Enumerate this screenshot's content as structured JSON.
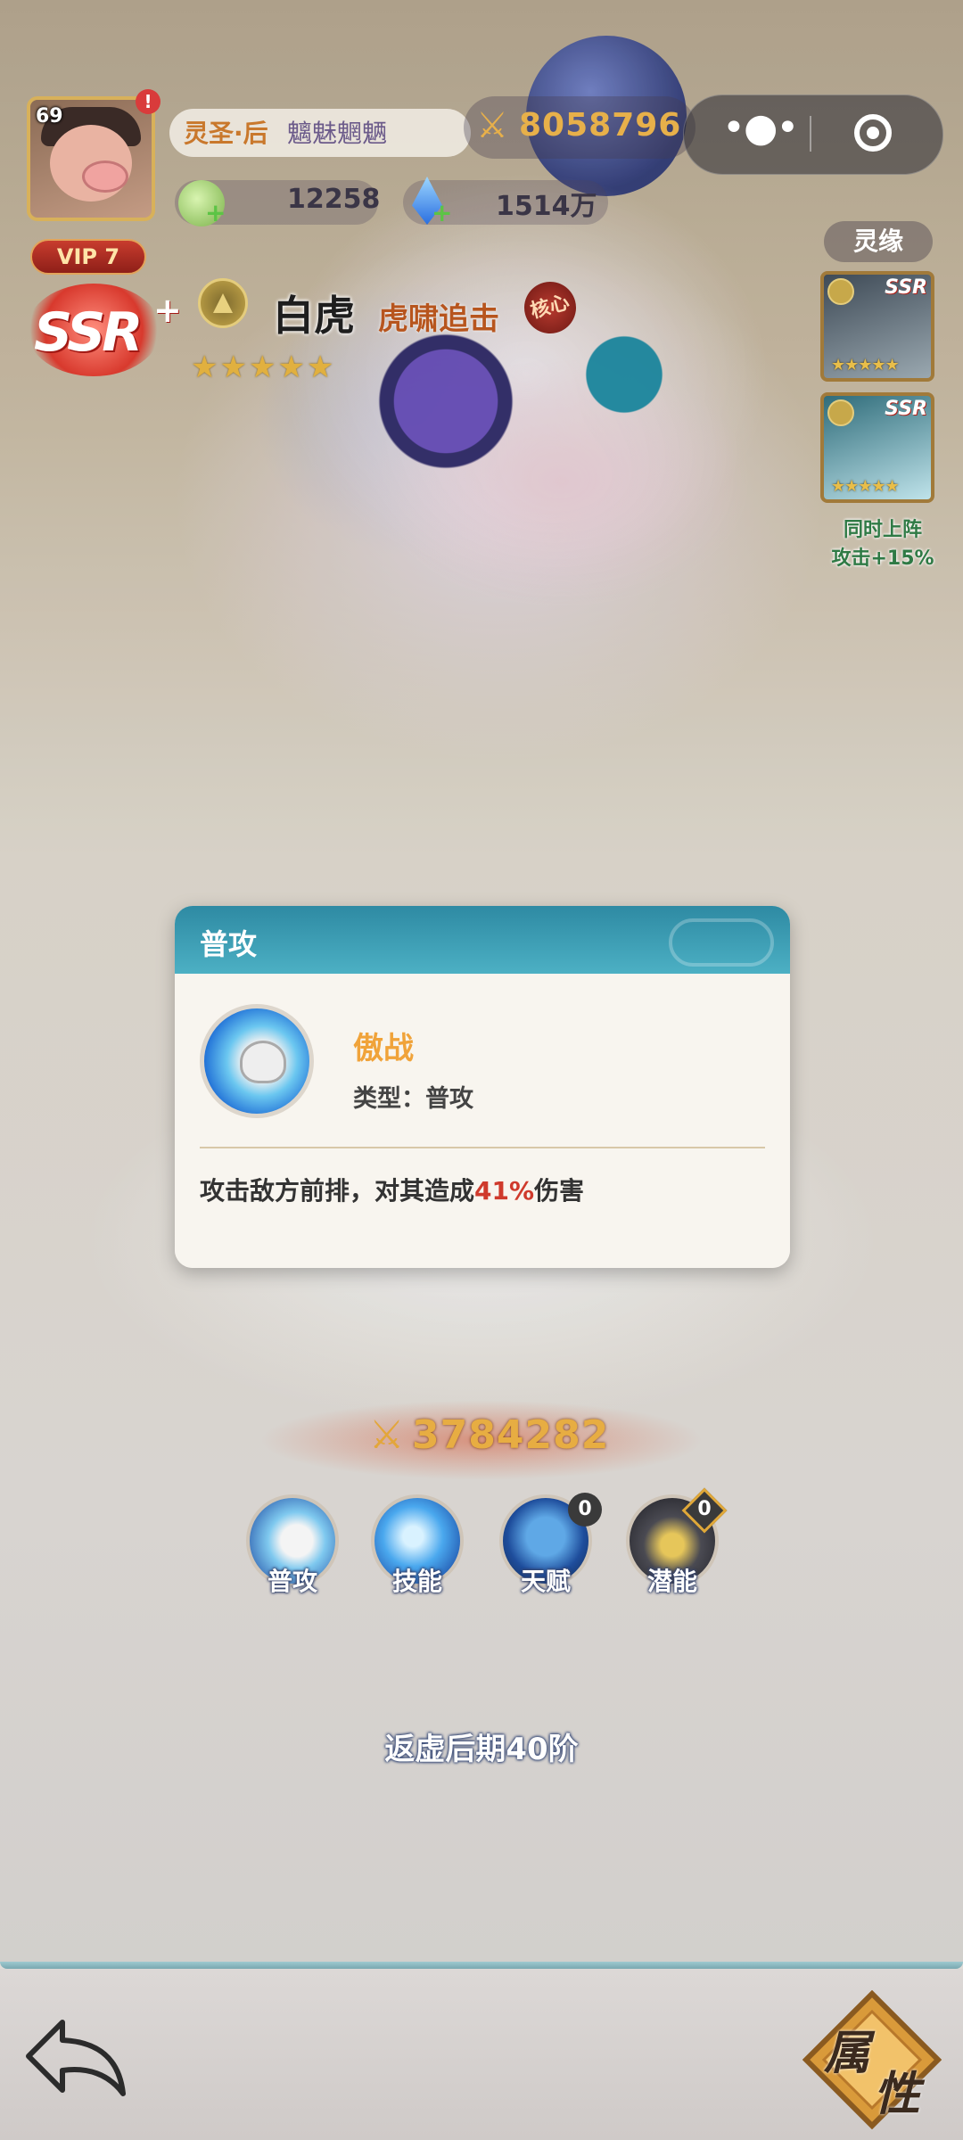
{
  "header": {
    "avatar_level": "69",
    "alert": "!",
    "title_rank": "灵圣·后",
    "title_name": "魑魅魍魉",
    "power": "8058796",
    "resource1": "12258",
    "resource2": "1514万",
    "vip": "VIP 7"
  },
  "hero": {
    "rarity": "SSR",
    "rarity_plus": "+",
    "name": "白虎",
    "title": "虎啸追击",
    "core_badge": "核心",
    "stars": "★★★★★",
    "star_count": 5
  },
  "linkage": {
    "button_label": "灵缘",
    "heroes": [
      {
        "tag": "SSR",
        "stars": "★★★★★"
      },
      {
        "tag": "SSR",
        "stars": "★★★★★"
      }
    ],
    "bonus_line1": "同时上阵",
    "bonus_line2": "攻击+15%"
  },
  "popup": {
    "header": "普攻",
    "skill_name": "傲战",
    "skill_type": "类型：普攻",
    "desc_before": "攻击敌方前排，对其造成",
    "desc_highlight": "41%",
    "desc_after": "伤害"
  },
  "combat_power": "3784282",
  "skills": [
    {
      "label": "普攻",
      "icon": "paw-icon"
    },
    {
      "label": "技能",
      "icon": "slash-icon"
    },
    {
      "label": "天赋",
      "icon": "tiger-icon",
      "count": "0"
    },
    {
      "label": "潜能",
      "icon": "lock-icon",
      "count": "0"
    }
  ],
  "rank_text": "返虚后期40阶",
  "bottom": {
    "attr_char1": "属",
    "attr_char2": "性"
  },
  "colors": {
    "accent_gold": "#e7ad42",
    "popup_header": "#2e8aa3",
    "highlight_red": "#cf3a2c",
    "skill_name_orange": "#f0a33a"
  }
}
